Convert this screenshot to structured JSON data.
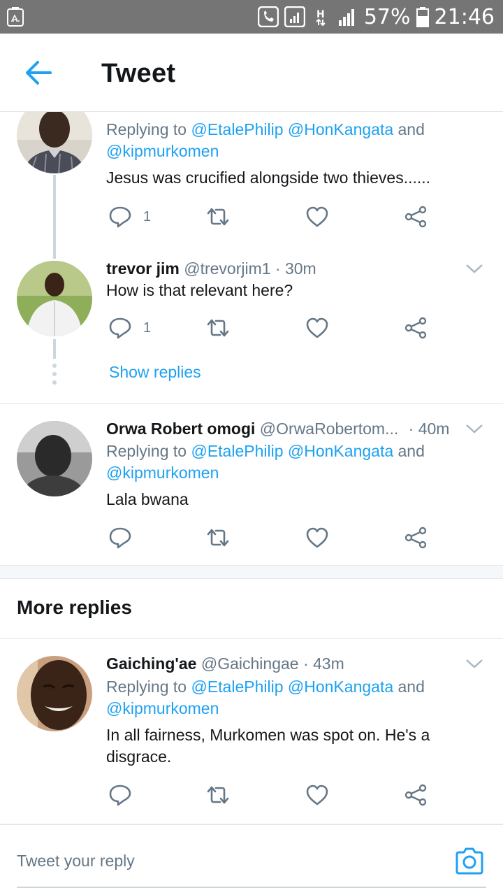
{
  "status_bar": {
    "battery": "57%",
    "time": "21:46"
  },
  "header": {
    "title": "Tweet"
  },
  "tweets": [
    {
      "name": "",
      "handle": "",
      "time": "",
      "replying_prefix": "Replying to",
      "mention1": "@EtalePhilip",
      "mention2": "@HonKangata",
      "and_word": "and",
      "mention3": "@kipmurkomen",
      "text": "Jesus was crucified alongside two thieves......",
      "reply_count": "1"
    },
    {
      "name": "trevor jim",
      "handle": "@trevorjim1",
      "time": "· 30m",
      "text": "How is that relevant here?",
      "reply_count": "1"
    },
    {
      "name": "Orwa Robert omogi",
      "handle": "@OrwaRobertom...",
      "time": "· 40m",
      "replying_prefix": "Replying to",
      "mention1": "@EtalePhilip",
      "mention2": "@HonKangata",
      "and_word": "and",
      "mention3": "@kipmurkomen",
      "text": "Lala bwana"
    },
    {
      "name": "Gaiching'ae",
      "handle": "@Gaichingae",
      "time": "· 43m",
      "replying_prefix": "Replying to",
      "mention1": "@EtalePhilip",
      "mention2": "@HonKangata",
      "and_word": "and",
      "mention3": "@kipmurkomen",
      "text": "In all fairness, Murkomen was spot on. He's a disgrace."
    }
  ],
  "thread": {
    "show_replies": "Show replies"
  },
  "sections": {
    "more_replies": "More replies"
  },
  "composer": {
    "placeholder": "Tweet your reply"
  },
  "colors": {
    "accent": "#1da1f2",
    "muted": "#657786",
    "divider": "#e1e8ed",
    "status_bar": "#757575"
  },
  "icons": [
    "back-arrow-icon",
    "reply-icon",
    "retweet-icon",
    "like-icon",
    "share-icon",
    "chevron-down-icon",
    "camera-icon"
  ]
}
